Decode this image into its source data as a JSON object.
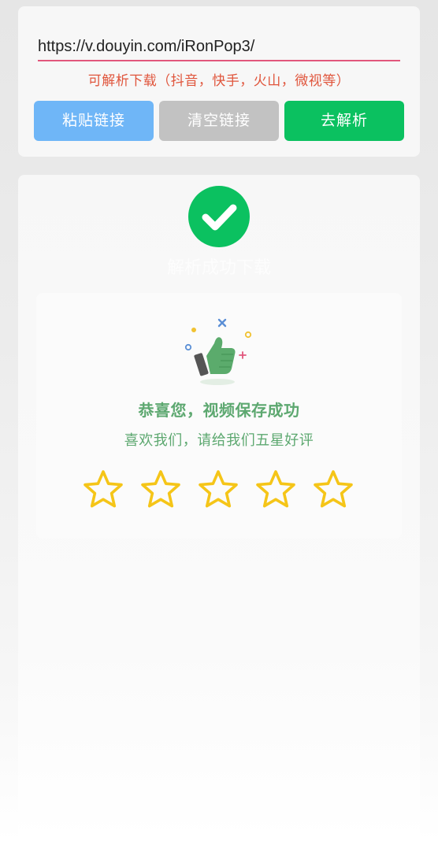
{
  "input": {
    "value": "https://v.douyin.com/iRonPop3/",
    "placeholder": ""
  },
  "hint": "可解析下载（抖音，快手，火山，微视等）",
  "buttons": {
    "paste": "粘贴链接",
    "clear": "清空链接",
    "parse": "去解析"
  },
  "result": {
    "faded_title": "解析成功下载",
    "congrats": "恭喜您，视频保存成功",
    "ask_rating": "喜欢我们，请给我们五星好评",
    "rating": {
      "filled": 0,
      "max": 5
    }
  },
  "colors": {
    "accent_pink": "#e2567c",
    "hint_red": "#e0553c",
    "paste_blue": "#6fb6f7",
    "clear_gray": "#c2c2c2",
    "parse_green": "#0bc160",
    "text_green": "#5da870",
    "star_yellow": "#f5c518"
  },
  "icons": {
    "success": "check-circle-icon",
    "thumbs_up": "thumbs-up-icon",
    "star": "star-outline-icon"
  }
}
